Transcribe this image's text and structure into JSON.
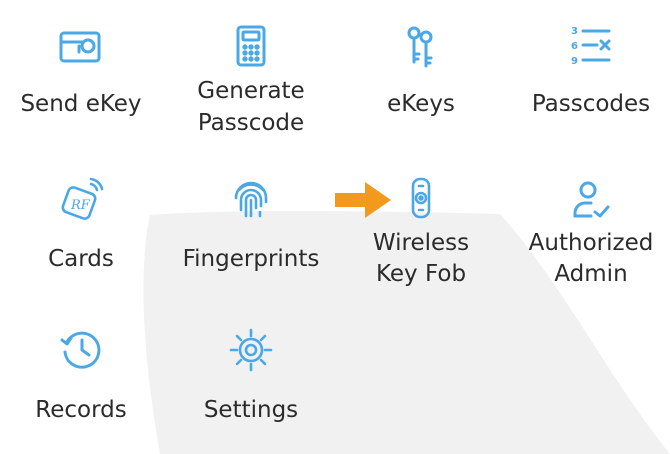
{
  "colors": {
    "icon": "#4aa8e6",
    "label": "#2b2b2b",
    "arrow": "#f39a1e",
    "backdrop": "#f1f1f1"
  },
  "menu": {
    "items": [
      {
        "icon": "card-key-icon",
        "label": "Send eKey"
      },
      {
        "icon": "calculator-icon",
        "label1": "Generate",
        "label2": "Passcode"
      },
      {
        "icon": "keys-icon",
        "label": "eKeys"
      },
      {
        "icon": "number-list-icon",
        "label": "Passcodes"
      },
      {
        "icon": "rf-card-icon",
        "label": "Cards"
      },
      {
        "icon": "fingerprint-icon",
        "label": "Fingerprints"
      },
      {
        "icon": "key-fob-icon",
        "label1": "Wireless",
        "label2": "Key Fob"
      },
      {
        "icon": "user-check-icon",
        "label1": "Authorized",
        "label2": "Admin"
      },
      {
        "icon": "history-clock-icon",
        "label": "Records"
      },
      {
        "icon": "gear-icon",
        "label": "Settings"
      }
    ]
  },
  "annotation": {
    "icon": "arrow-right-icon"
  }
}
